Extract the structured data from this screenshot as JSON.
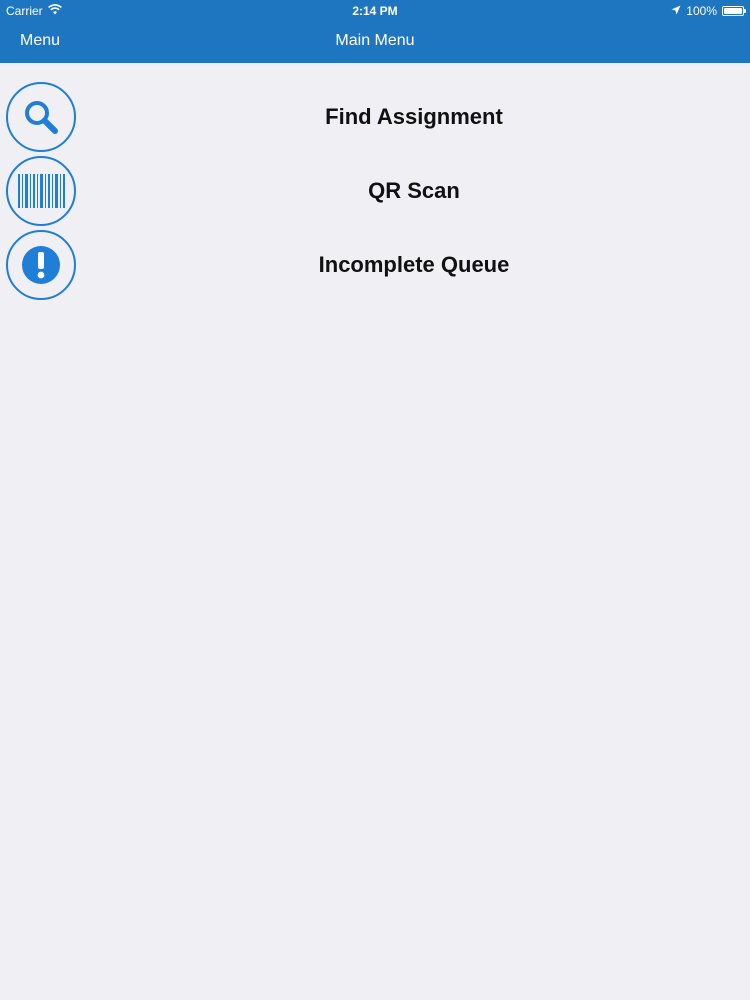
{
  "status_bar": {
    "carrier": "Carrier",
    "time": "2:14 PM",
    "battery": "100%",
    "battery_level": 1.0
  },
  "nav": {
    "menu_label": "Menu",
    "title": "Main Menu"
  },
  "colors": {
    "accent": "#1f76c0",
    "icon": "#1f7ed6",
    "background": "#efeff4"
  },
  "items": [
    {
      "label": "Find Assignment",
      "icon": "search-icon"
    },
    {
      "label": "QR Scan",
      "icon": "barcode-icon"
    },
    {
      "label": "Incomplete Queue",
      "icon": "exclamation-icon"
    }
  ]
}
